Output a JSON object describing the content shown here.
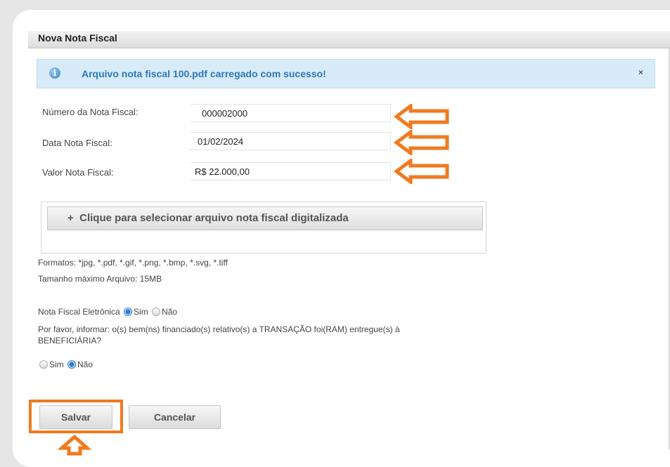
{
  "dialog": {
    "title": "Nova Nota Fiscal"
  },
  "notice": {
    "icon": "info-icon",
    "message": "Arquivo nota fiscal 100.pdf carregado com sucesso!",
    "close": "×"
  },
  "form": {
    "numero": {
      "label": "Número da Nota Fiscal:",
      "value": "000002000"
    },
    "data": {
      "label": "Data Nota Fiscal:",
      "value": "01/02/2024"
    },
    "valor": {
      "label": "Valor Nota Fiscal:",
      "value": "R$ 22.000,00"
    }
  },
  "upload": {
    "plus": "+",
    "label": "Clique para selecionar arquivo nota fiscal digitalizada",
    "formats": "Formatos: *jpg, *.pdf, *.gif, *.png, *.bmp, *.svg, *.tiff",
    "max_size": "Tamanho máximo Arquivo: 15MB"
  },
  "nfe": {
    "label": "Nota Fiscal Eletrônica",
    "sim": "Sim",
    "nao": "Não",
    "selected": "Sim"
  },
  "entrega": {
    "question_line1": "Por favor, informar: o(s) bem(ns) financiado(s) relativo(s) a TRANSAÇÃO foi(RAM) entregue(s) à",
    "question_line2": "BENEFICIÁRIA?",
    "sim": "Sim",
    "nao": "Não",
    "selected": "Não"
  },
  "actions": {
    "save": "Salvar",
    "cancel": "Cancelar"
  },
  "colors": {
    "highlight": "#f07a20",
    "notice_bg": "#d7ebf8",
    "notice_text": "#2e79b8"
  }
}
